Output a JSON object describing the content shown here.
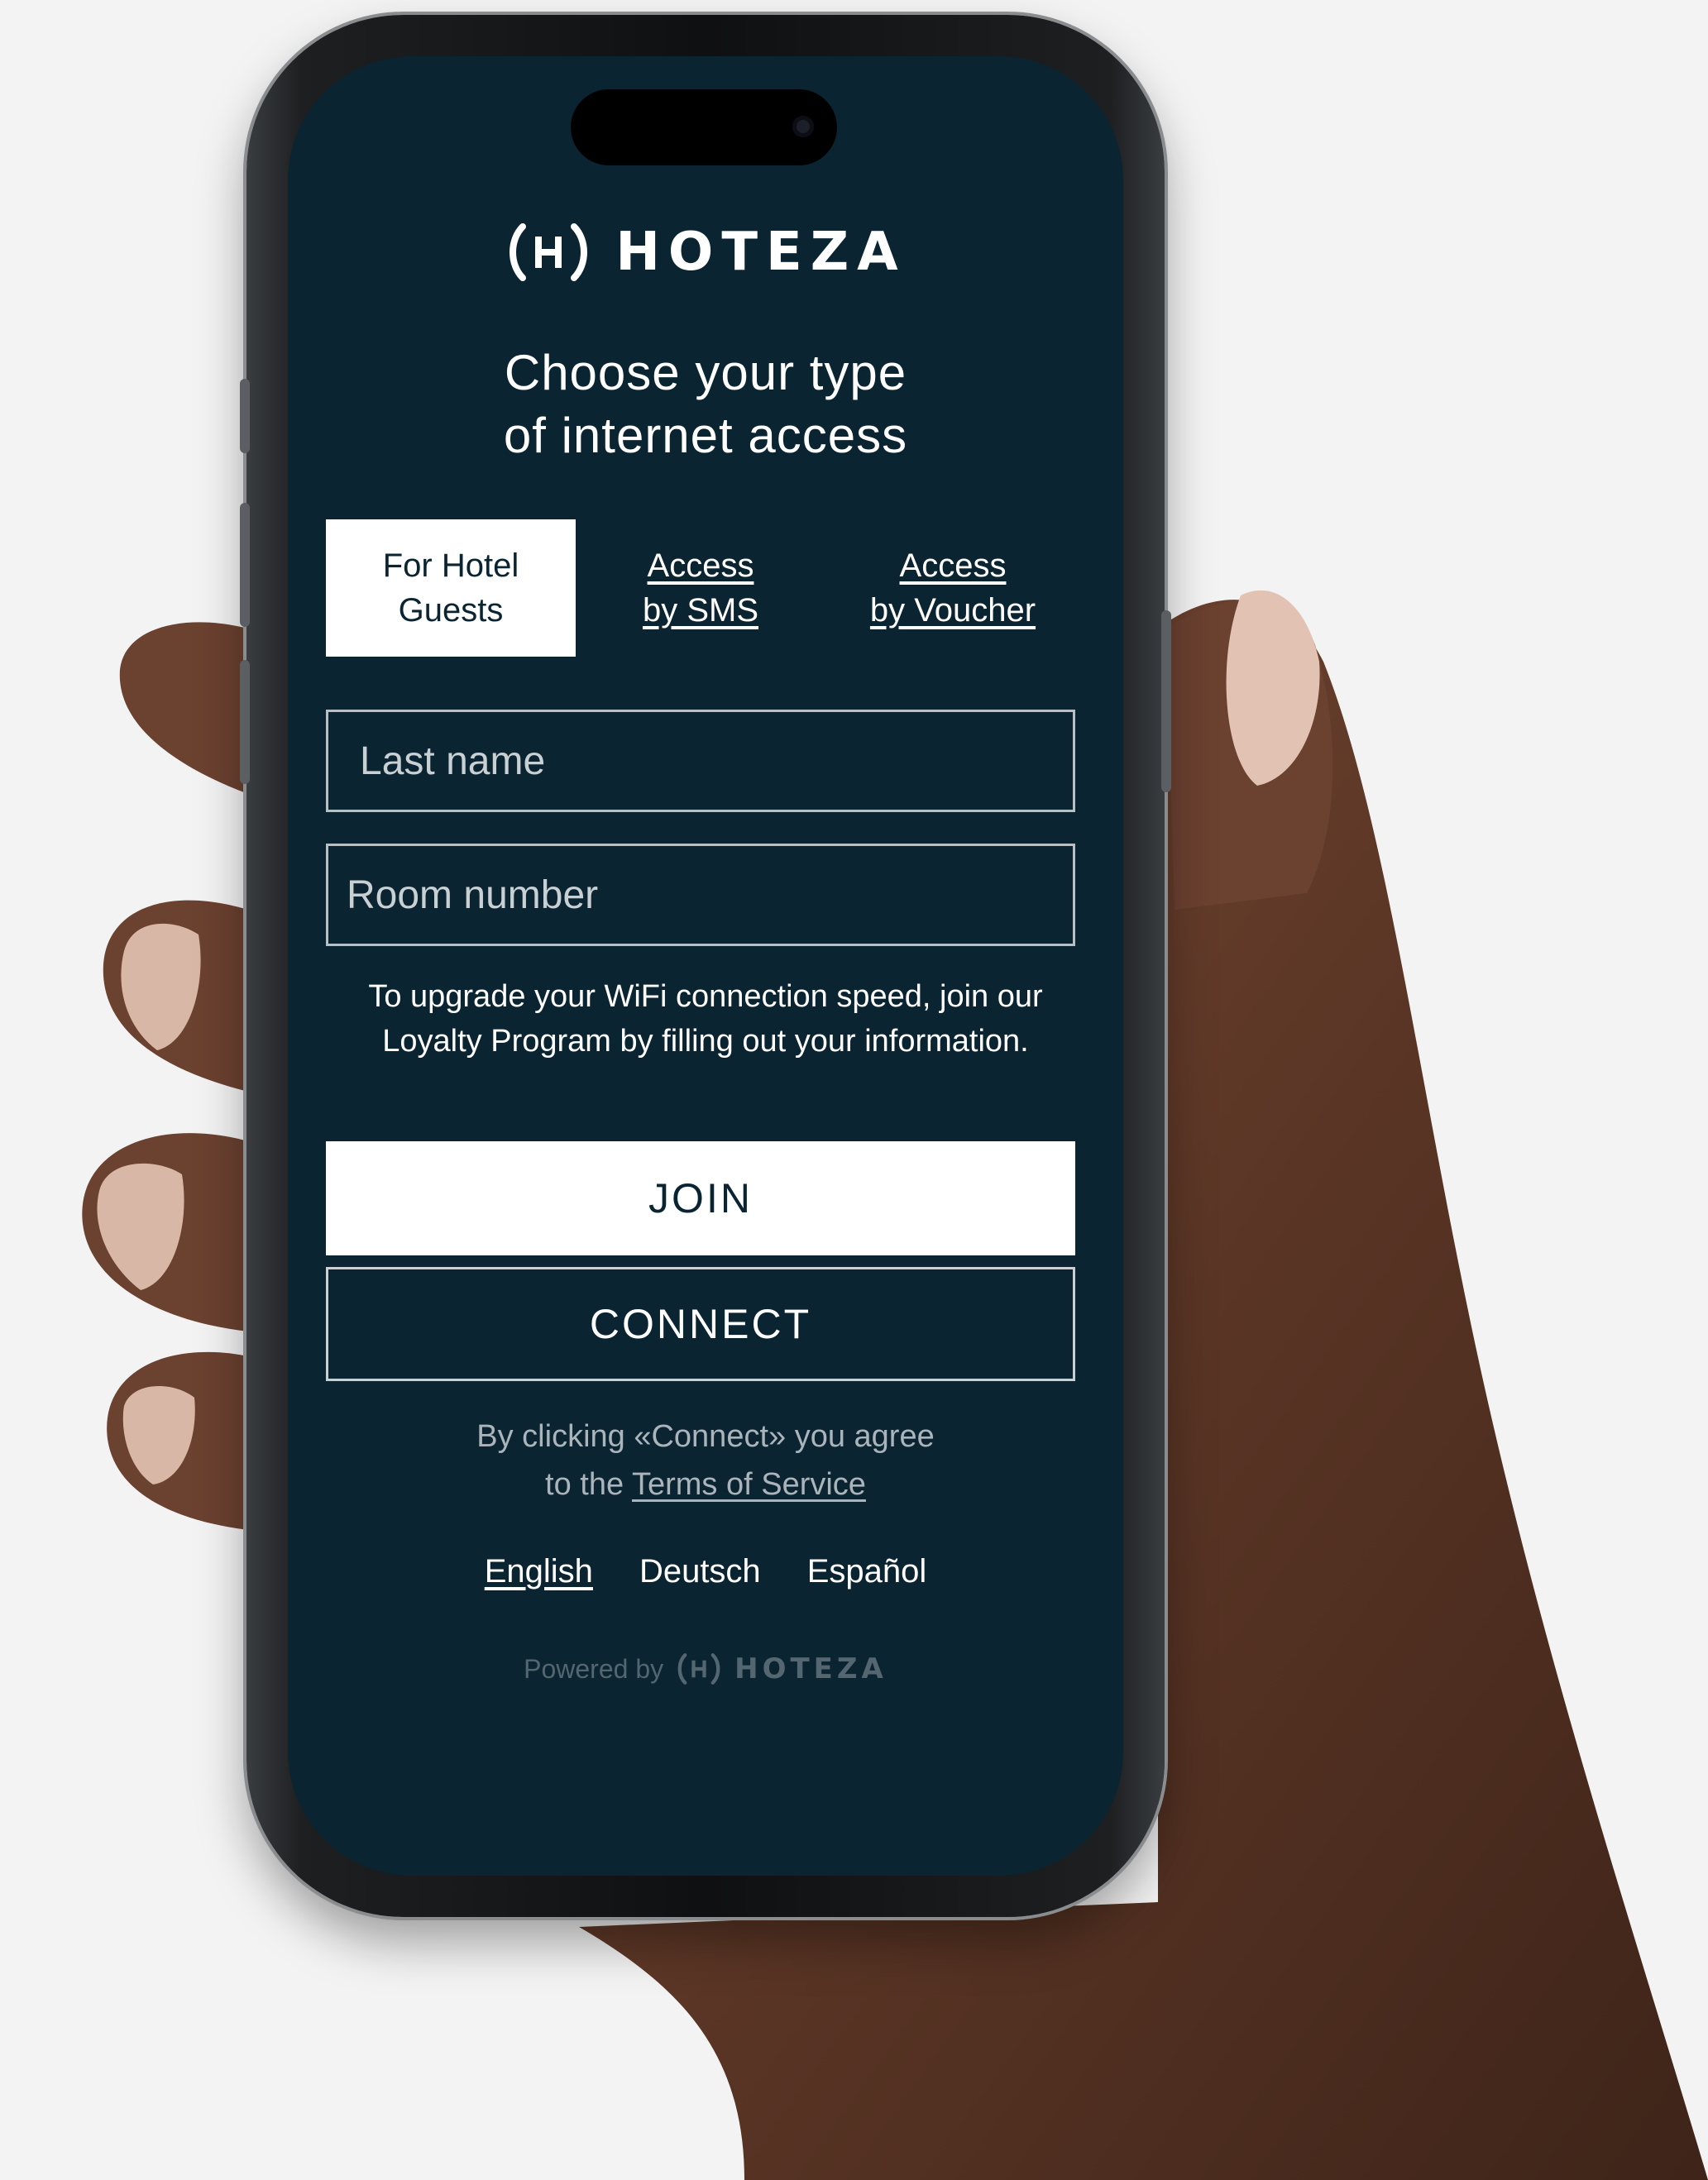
{
  "brand": {
    "name": "HOTEZA"
  },
  "heading": {
    "line1": "Choose your type",
    "line2": "of internet access"
  },
  "tabs": [
    {
      "line1": "For Hotel",
      "line2": "Guests",
      "active": true
    },
    {
      "line1": "Access",
      "line2": "by SMS",
      "active": false
    },
    {
      "line1": "Access",
      "line2": "by Voucher",
      "active": false
    }
  ],
  "form": {
    "last_name_placeholder": "Last name",
    "room_number_placeholder": "Room number"
  },
  "info_text": "To upgrade your WiFi connection speed, join our Loyalty Program by filling out your information.",
  "buttons": {
    "join": "JOIN",
    "connect": "CONNECT"
  },
  "terms": {
    "prefix": "By clicking «Connect» you agree",
    "to_the": "to the",
    "link": "Terms of Service"
  },
  "languages": [
    {
      "label": "English",
      "active": true
    },
    {
      "label": "Deutsch",
      "active": false
    },
    {
      "label": "Español",
      "active": false
    }
  ],
  "footer": {
    "powered_by": "Powered by",
    "brand": "HOTEZA"
  },
  "colors": {
    "screen_bg": "#0b2431",
    "text": "#ffffff",
    "muted": "#aab4ba",
    "background": "#f3f3f3"
  }
}
